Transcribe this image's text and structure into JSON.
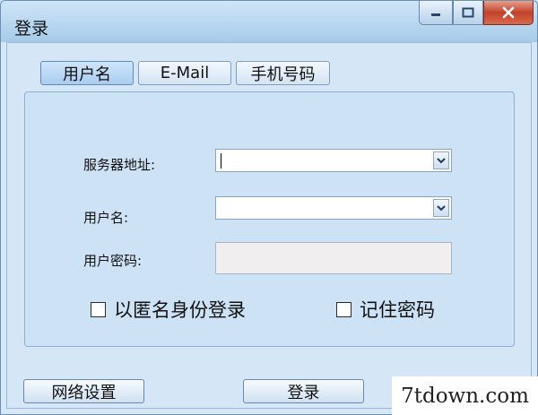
{
  "window": {
    "title": "登录",
    "controls": {
      "minimize_icon": "minimize-icon",
      "maximize_icon": "maximize-icon",
      "close_icon": "close-icon"
    }
  },
  "tabs": [
    {
      "label": "用户名",
      "active": true
    },
    {
      "label": "E-Mail",
      "active": false
    },
    {
      "label": "手机号码",
      "active": false
    }
  ],
  "form": {
    "server_label": "服务器地址:",
    "server_value": "",
    "username_label": "用户名:",
    "username_value": "",
    "password_label": "用户密码:",
    "password_value": "",
    "anonymous_label": "以匿名身份登录",
    "anonymous_checked": false,
    "remember_label": "记住密码",
    "remember_checked": false
  },
  "buttons": {
    "network_settings": "网络设置",
    "login": "登录"
  },
  "watermark": "7tdown.com",
  "colors": {
    "accent": "#a9cdef",
    "close": "#c3412a",
    "background": "#d5e7f6"
  }
}
